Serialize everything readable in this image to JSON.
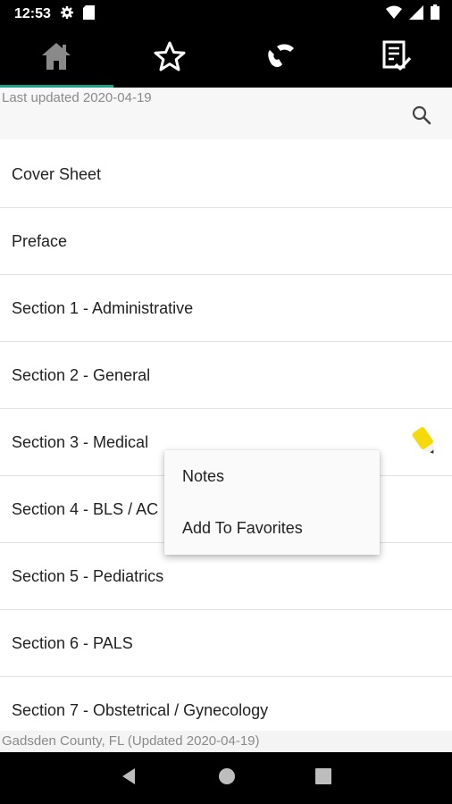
{
  "status_bar": {
    "time": "12:53"
  },
  "subheader": {
    "last_updated": "Last updated 2020-04-19"
  },
  "list": {
    "items": [
      {
        "label": "Cover Sheet"
      },
      {
        "label": "Preface"
      },
      {
        "label": "Section 1 - Administrative"
      },
      {
        "label": "Section 2 - General"
      },
      {
        "label": "Section 3 - Medical"
      },
      {
        "label": "Section 4 - BLS / AC"
      },
      {
        "label": "Section 5 - Pediatrics"
      },
      {
        "label": "Section 6 - PALS"
      },
      {
        "label": "Section 7 - Obstetrical / Gynecology"
      }
    ]
  },
  "context_menu": {
    "items": [
      {
        "label": "Notes"
      },
      {
        "label": "Add To Favorites"
      }
    ]
  },
  "footer": {
    "text": "Gadsden County, FL (Updated 2020-04-19)"
  },
  "colors": {
    "accent": "#1e9f87",
    "highlighter": "#f5d90a"
  },
  "icons": {
    "tabs": [
      "home-icon",
      "star-icon",
      "phone-icon",
      "checklist-icon"
    ],
    "nav": [
      "back-icon",
      "home-circle-icon",
      "recents-icon"
    ]
  }
}
